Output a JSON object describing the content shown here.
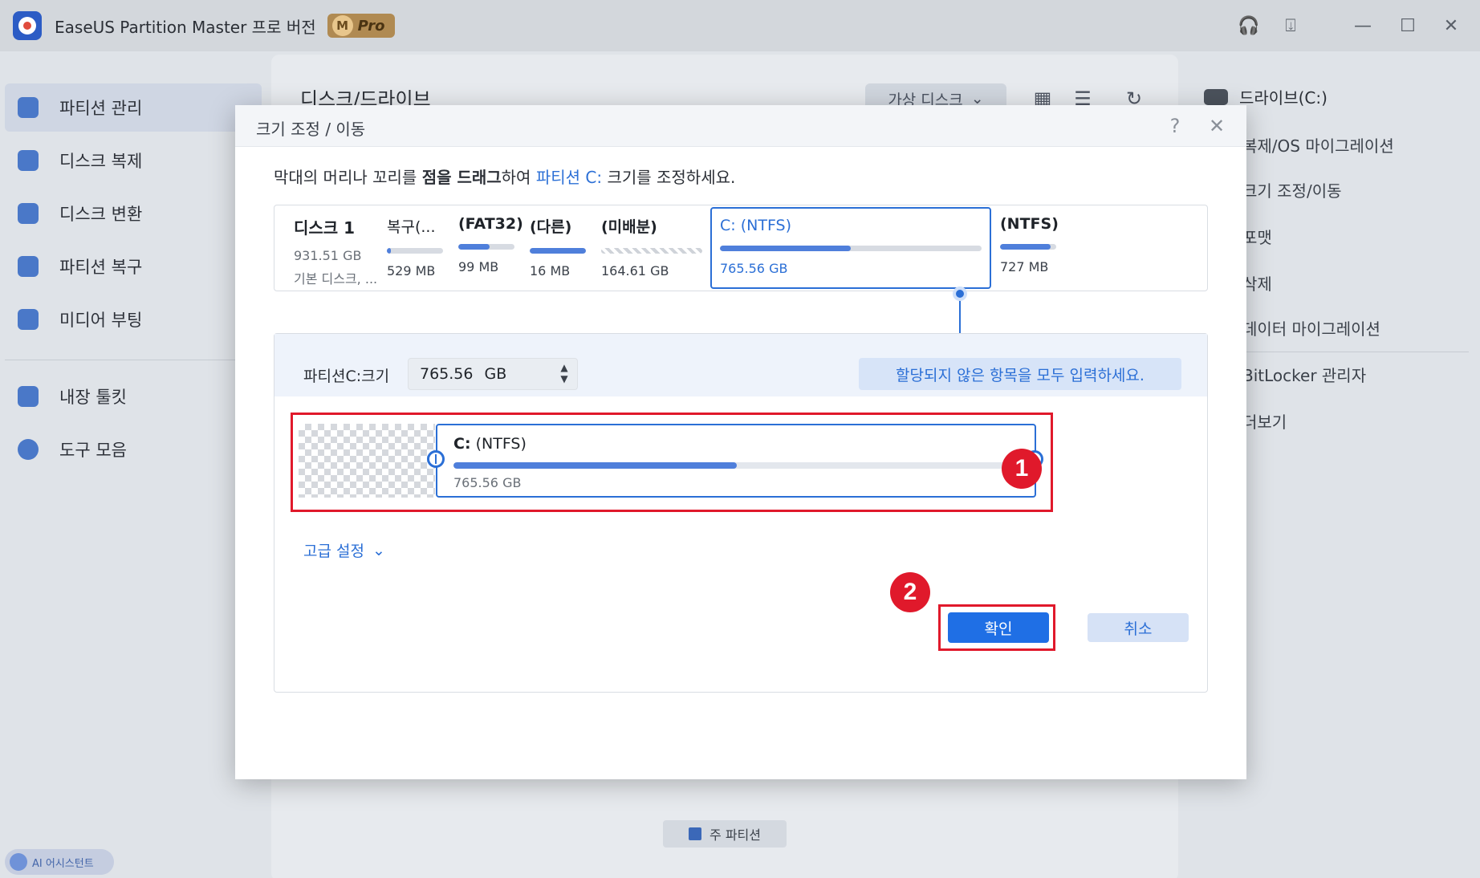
{
  "app": {
    "title": "EaseUS Partition Master 프로 버전",
    "pro_badge_letter": "M",
    "pro_badge_text": "Pro"
  },
  "sidebar": {
    "items": [
      {
        "label": "파티션 관리",
        "icon": "pie-chart-icon"
      },
      {
        "label": "디스크 복제",
        "icon": "copy-icon"
      },
      {
        "label": "디스크 변환",
        "icon": "convert-icon"
      },
      {
        "label": "파티션 복구",
        "icon": "recover-icon"
      },
      {
        "label": "미디어 부팅",
        "icon": "usb-icon"
      },
      {
        "label": "내장 툴킷",
        "icon": "toolbox-icon"
      },
      {
        "label": "도구 모음",
        "icon": "compass-icon"
      }
    ],
    "ai_assistant": "AI 어시스턴트"
  },
  "main": {
    "title": "디스크/드라이브",
    "virtual_disk": "가상 디스크",
    "legend_primary": "주 파티션"
  },
  "right_panel": {
    "drive": "드라이브(C:)",
    "operations": [
      "복제/OS 마이그레이션",
      "크기 조정/이동",
      "포맷",
      "삭제",
      "데이터 마이그레이션",
      "BitLocker 관리자",
      "더보기"
    ]
  },
  "dialog": {
    "title": "크기 조정 / 이동",
    "instruction": {
      "part1": "막대의 머리나 꼬리를 ",
      "bold": "점을 드래그",
      "part2": "하여 ",
      "highlight": "파티션 C:",
      "part3": " 크기를 조정하세요."
    },
    "disk": {
      "name": "디스크 1",
      "size": "931.51 GB",
      "type": "기본 디스크, ..."
    },
    "partitions": [
      {
        "name": "복구(...",
        "size": "529 MB",
        "fill": 0.07
      },
      {
        "name": "(FAT32)",
        "size": "99 MB",
        "fill": 0.55
      },
      {
        "name": "(다른)",
        "size": "16 MB",
        "fill": 1.0
      },
      {
        "name": "(미배분)",
        "size": "164.61 GB",
        "fill": 0
      },
      {
        "name": "C: (NTFS)",
        "size": "765.56 GB",
        "fill": 0.5
      },
      {
        "name": "(NTFS)",
        "size": "727 MB",
        "fill": 0.9
      }
    ],
    "size_label": "파티션C:크기",
    "size_value": "765.56",
    "size_unit": "GB",
    "fill_all_button": "할당되지 않은 항목을 모두 입력하세요.",
    "resize_partition": {
      "name_bold": "C:",
      "name_rest": " (NTFS)",
      "size": "765.56 GB",
      "fill": 0.5
    },
    "advanced_settings": "고급 설정",
    "ok_button": "확인",
    "cancel_button": "취소",
    "step_badges": [
      "1",
      "2"
    ]
  },
  "colors": {
    "accent": "#2b6fd6",
    "primary_button": "#1f6fe5",
    "highlight_red": "#e0192b"
  }
}
